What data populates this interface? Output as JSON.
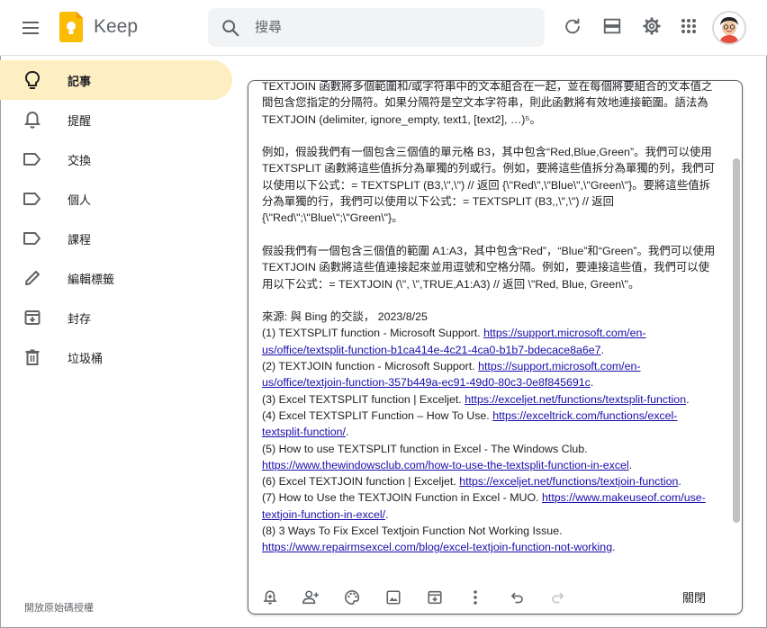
{
  "header": {
    "app_name": "Keep",
    "search_placeholder": "搜尋",
    "icons": [
      "menu-icon",
      "keep-logo-icon",
      "search-icon",
      "refresh-icon",
      "list-view-icon",
      "settings-icon",
      "apps-grid-icon"
    ]
  },
  "sidebar": {
    "items": [
      {
        "label": "記事",
        "icon": "lightbulb-icon",
        "active": true
      },
      {
        "label": "提醒",
        "icon": "bell-icon"
      },
      {
        "label": "交換",
        "icon": "label-icon"
      },
      {
        "label": "個人",
        "icon": "label-icon"
      },
      {
        "label": "課程",
        "icon": "label-icon"
      },
      {
        "label": "編輯標籤",
        "icon": "pencil-icon"
      },
      {
        "label": "封存",
        "icon": "archive-icon"
      },
      {
        "label": "垃圾桶",
        "icon": "trash-icon"
      }
    ],
    "license": "開放原始碼授權"
  },
  "note": {
    "p1": "TEXTJOIN 函數將多個範圍和/或字符串中的文本組合在一起，並在每個將要組合的文本值之間包含您指定的分隔符。如果分隔符是空文本字符串，則此函數將有效地連接範圍。語法為 TEXTJOIN (delimiter, ignore_empty, text1, [text2], …)⁵。",
    "p2": "例如，假設我們有一個包含三個值的單元格 B3，其中包含“Red,Blue,Green”。我們可以使用 TEXTSPLIT 函數將這些值拆分為單獨的列或行。例如，要將這些值拆分為單獨的列，我們可以使用以下公式：= TEXTSPLIT (B3,\\\",\\\") // 返回 {\\\"Red\\\",\\\"Blue\\\",\\\"Green\\\"}。要將這些值拆分為單獨的行，我們可以使用以下公式：= TEXTSPLIT (B3,,\\\",\\\") // 返回 {\\\"Red\\\";\\\"Blue\\\";\\\"Green\\\"}。",
    "p3": "假設我們有一個包含三個值的範圍 A1:A3，其中包含“Red”，“Blue”和“Green”。我們可以使用 TEXTJOIN 函數將這些值連接起來並用逗號和空格分隔。例如，要連接這些值，我們可以使用以下公式：= TEXTJOIN (\\\", \\\",TRUE,A1:A3) // 返回 \\\"Red, Blue, Green\\\"。",
    "source": "來源: 與 Bing 的交談， 2023/8/25",
    "refs": [
      {
        "text": "(1) TEXTSPLIT function - Microsoft Support. ",
        "url": "https://support.microsoft.com/en-us/office/textsplit-function-b1ca414e-4c21-4ca0-b1b7-bdecace8a6e7",
        "after": "."
      },
      {
        "text": "(2) TEXTJOIN function - Microsoft Support. ",
        "url": "https://support.microsoft.com/en-us/office/textjoin-function-357b449a-ec91-49d0-80c3-0e8f845691c",
        "after": "."
      },
      {
        "text": "(3) Excel TEXTSPLIT function | Exceljet. ",
        "url": "https://exceljet.net/functions/textsplit-function",
        "after": "."
      },
      {
        "text": "(4) Excel TEXTSPLIT Function – How To Use. ",
        "url": "https://exceltrick.com/functions/excel-textsplit-function/",
        "after": "."
      },
      {
        "text": "(5) How to use TEXTSPLIT function in Excel - The Windows Club. ",
        "url": "https://www.thewindowsclub.com/how-to-use-the-textsplit-function-in-excel",
        "after": "."
      },
      {
        "text": "(6) Excel TEXTJOIN function | Exceljet. ",
        "url": "https://exceljet.net/functions/textjoin-function",
        "after": "."
      },
      {
        "text": "(7) How to Use the TEXTJOIN Function in Excel - MUO. ",
        "url": "https://www.makeuseof.com/use-textjoin-function-in-excel/",
        "after": "."
      },
      {
        "text": "(8) 3 Ways To Fix Excel Textjoin Function Not Working Issue. ",
        "url": "https://www.repairmsexcel.com/blog/excel-textjoin-function-not-working",
        "after": "."
      }
    ],
    "close_label": "關閉",
    "toolbar_icons": [
      "remind-me-icon",
      "collaborator-icon",
      "palette-icon",
      "image-icon",
      "archive-icon",
      "more-icon",
      "undo-icon",
      "redo-icon"
    ]
  },
  "colors": {
    "active_nav": "#feefc3",
    "link": "#1a0dab",
    "logo_yellow": "#fbbc04"
  }
}
